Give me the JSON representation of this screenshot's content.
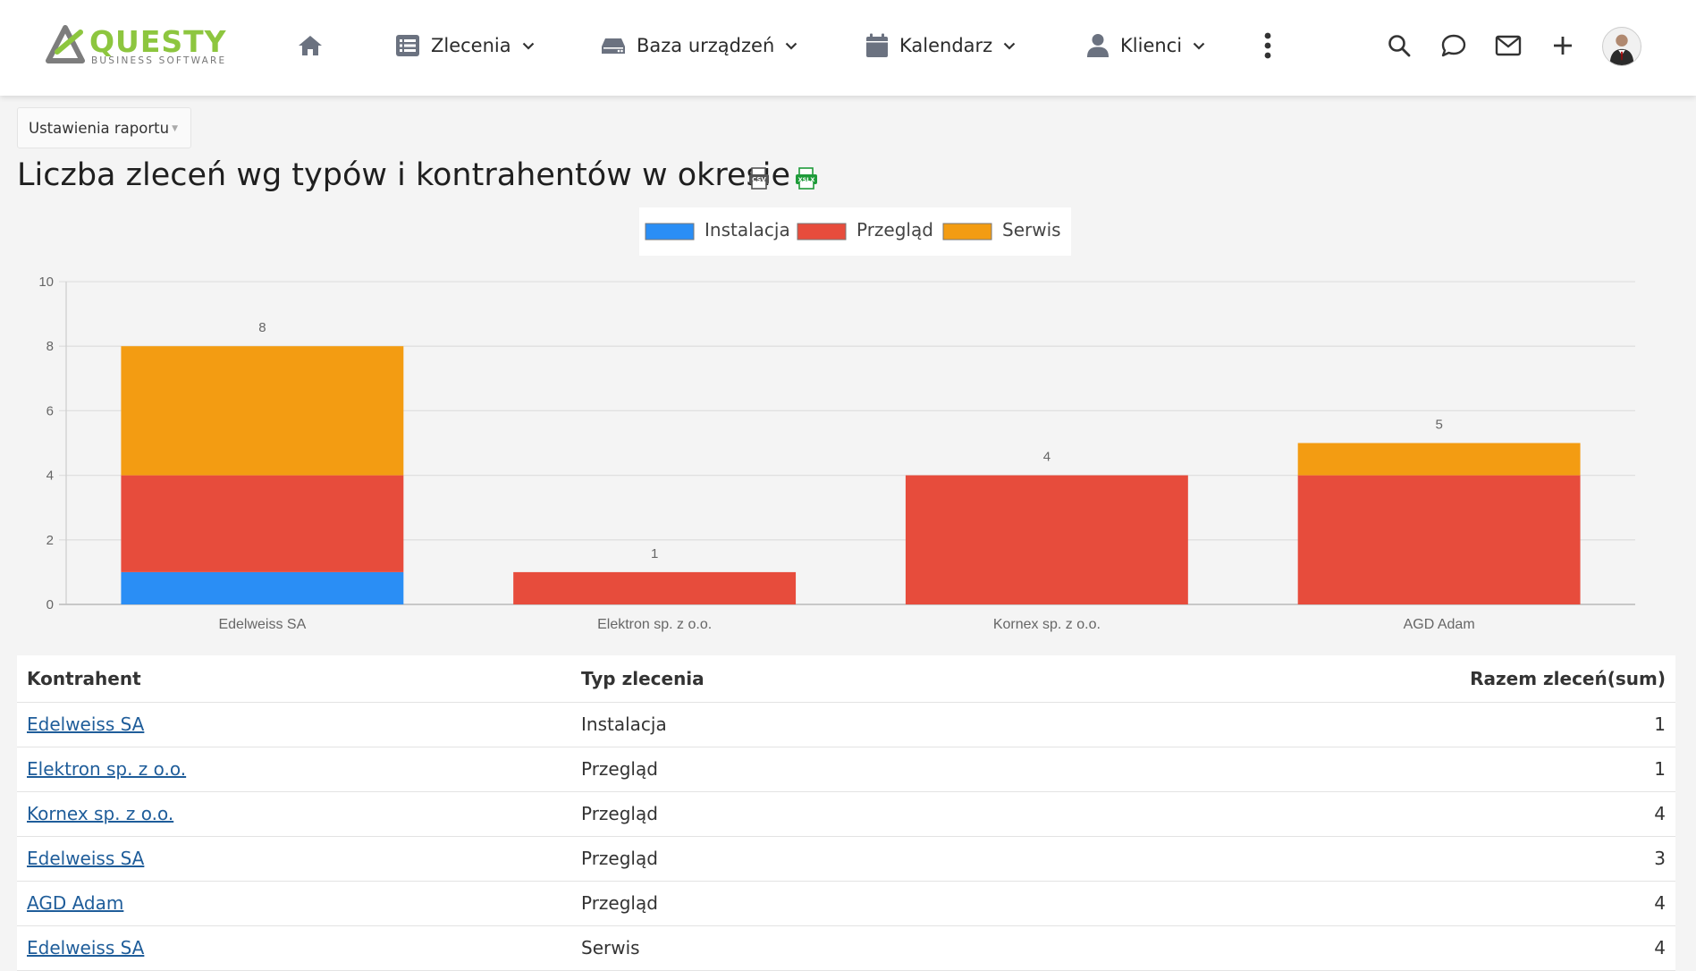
{
  "brand": {
    "name": "QUESTY",
    "tagline": "BUSINESS SOFTWARE",
    "color": "#8dc63f"
  },
  "nav": {
    "items": [
      {
        "label": "Zlecenia",
        "icon": "list-icon"
      },
      {
        "label": "Baza urządzeń",
        "icon": "device-icon"
      },
      {
        "label": "Kalendarz",
        "icon": "calendar-icon"
      },
      {
        "label": "Klienci",
        "icon": "user-icon"
      }
    ],
    "icons": [
      "home-icon",
      "more-vertical-icon",
      "search-icon",
      "chat-icon",
      "mail-icon",
      "plus-icon",
      "avatar"
    ]
  },
  "report": {
    "settings_label": "Ustawienia raportu",
    "title": "Liczba zleceń wg typów i kontrahentów w okresie",
    "export_icons": [
      "csv-icon",
      "xslx-icon"
    ]
  },
  "chart_data": {
    "type": "bar",
    "stacked": true,
    "categories": [
      "Edelweiss SA",
      "Elektron sp. z o.o.",
      "Kornex sp. z o.o.",
      "AGD Adam"
    ],
    "series": [
      {
        "name": "Instalacja",
        "color": "#2a8ef5",
        "values": [
          1,
          0,
          0,
          0
        ]
      },
      {
        "name": "Przegląd",
        "color": "#e74c3c",
        "values": [
          3,
          1,
          4,
          4
        ]
      },
      {
        "name": "Serwis",
        "color": "#f39c12",
        "values": [
          4,
          0,
          0,
          1
        ]
      }
    ],
    "totals": [
      8,
      1,
      4,
      5
    ],
    "ylim": [
      0,
      10
    ],
    "yticks": [
      0,
      2,
      4,
      6,
      8,
      10
    ],
    "grid": true,
    "legend_position": "top-center"
  },
  "table": {
    "headers": {
      "contractor": "Kontrahent",
      "type": "Typ zlecenia",
      "total": "Razem zleceń(sum)"
    },
    "rows": [
      {
        "contractor": "Edelweiss SA",
        "type": "Instalacja",
        "total": "1"
      },
      {
        "contractor": "Elektron sp. z o.o.",
        "type": "Przegląd",
        "total": "1"
      },
      {
        "contractor": "Kornex sp. z o.o.",
        "type": "Przegląd",
        "total": "4"
      },
      {
        "contractor": "Edelweiss SA",
        "type": "Przegląd",
        "total": "3"
      },
      {
        "contractor": "AGD Adam",
        "type": "Przegląd",
        "total": "4"
      },
      {
        "contractor": "Edelweiss SA",
        "type": "Serwis",
        "total": "4"
      }
    ]
  }
}
